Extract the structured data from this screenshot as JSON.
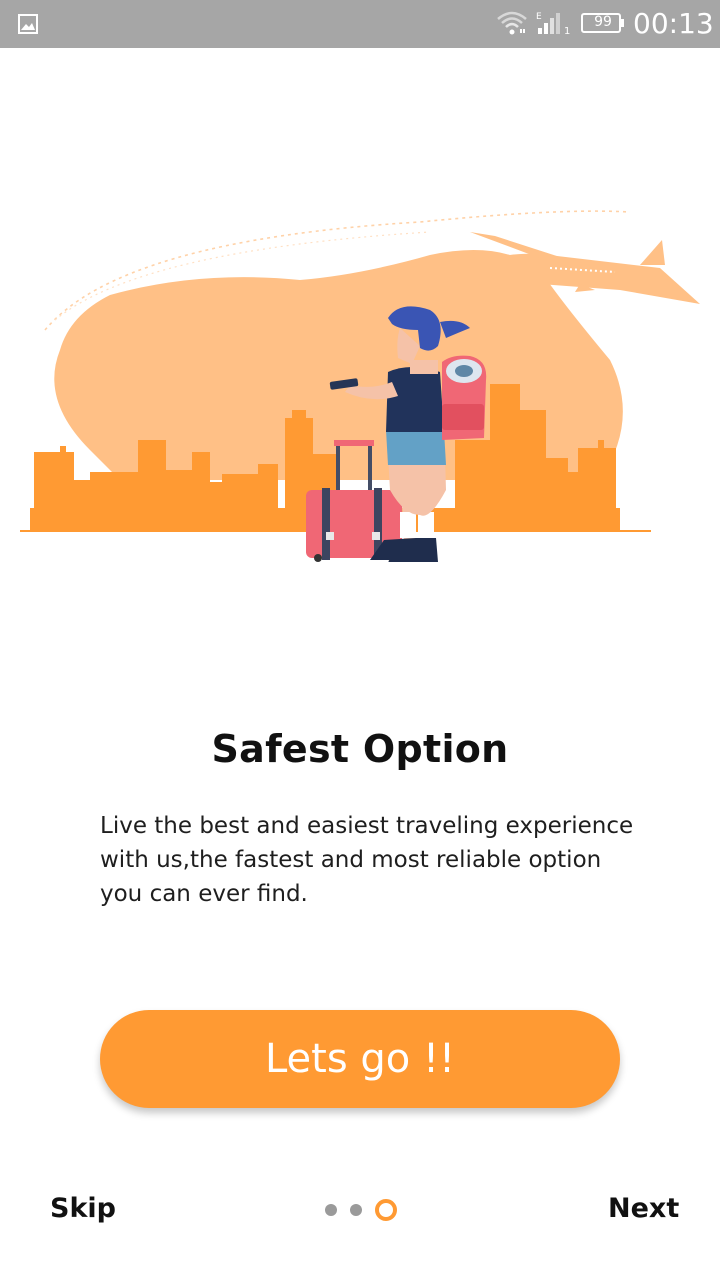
{
  "status_bar": {
    "battery": "99",
    "time": "00:13"
  },
  "onboarding": {
    "title": "Safest Option",
    "description": "Live the best and easiest traveling experience with us,the fastest and most reliable option you can ever find.",
    "cta_label": "Lets go !!",
    "skip_label": "Skip",
    "next_label": "Next",
    "page_indicator": {
      "total": 3,
      "current": 3
    }
  },
  "colors": {
    "accent": "#ff9a33",
    "blob": "#ffc086",
    "status_bar": "#a6a6a6",
    "suitcase": "#f06775"
  },
  "icons": [
    "image-icon",
    "wifi-icon",
    "signal-icon",
    "battery-icon"
  ]
}
